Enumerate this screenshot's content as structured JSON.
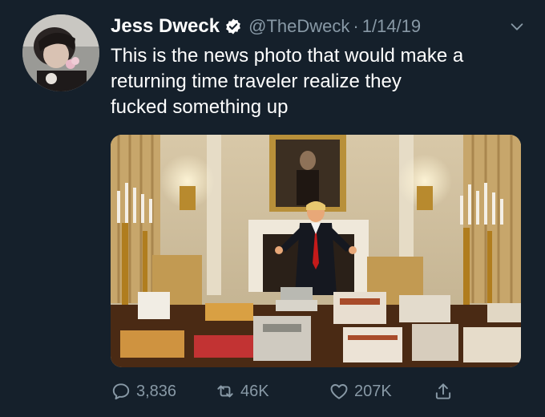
{
  "tweet": {
    "display_name": "Jess Dweck",
    "handle": "@TheDweck",
    "separator": "·",
    "date": "1/14/19",
    "text": "This is the news photo that would make a\nreturning time traveler realize they\nfucked something up",
    "verified": true,
    "icons": {
      "avatar": "avatar",
      "verified": "verified-badge-icon",
      "more": "chevron-down-icon",
      "photo": "news-photo"
    }
  },
  "actions": {
    "reply_count": "3,836",
    "retweet_count": "46K",
    "like_count": "207K",
    "icons": [
      "reply-icon",
      "retweet-icon",
      "like-icon",
      "share-icon"
    ]
  },
  "colors": {
    "background": "#15202b",
    "text": "#ffffff",
    "muted": "#8899a6",
    "verified": "#ffffff"
  }
}
